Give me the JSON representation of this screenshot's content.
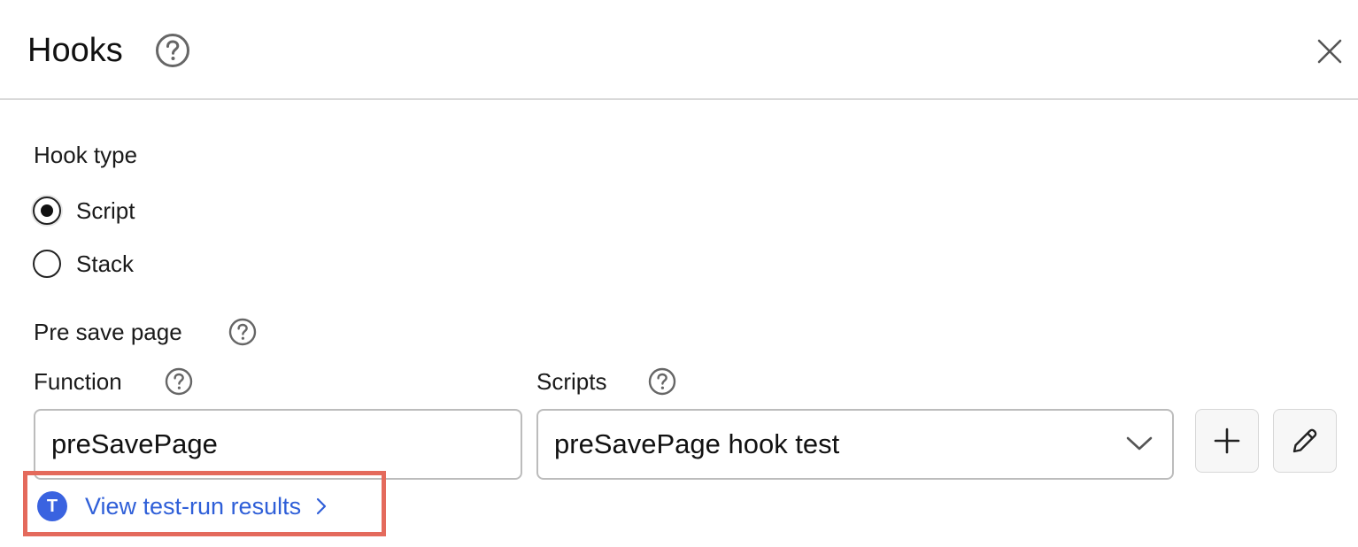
{
  "header": {
    "title": "Hooks"
  },
  "hook_type": {
    "label": "Hook type",
    "options": [
      {
        "label": "Script",
        "selected": true
      },
      {
        "label": "Stack",
        "selected": false
      }
    ]
  },
  "pre_save_page": {
    "label": "Pre save page"
  },
  "function_field": {
    "label": "Function",
    "value": "preSavePage"
  },
  "scripts_field": {
    "label": "Scripts",
    "selected": "preSavePage hook test"
  },
  "test_run": {
    "avatar_initial": "T",
    "link_text": "View test-run results"
  },
  "icons": {
    "help": "question-circle-icon",
    "close": "close-icon",
    "add": "plus-icon",
    "edit": "pencil-icon",
    "dropdown": "chevron-down-icon",
    "link": "chevron-right-icon"
  },
  "colors": {
    "accent_link": "#2f5fd8",
    "avatar_bg": "#3a63e0",
    "highlight_border": "#e46a5c"
  }
}
